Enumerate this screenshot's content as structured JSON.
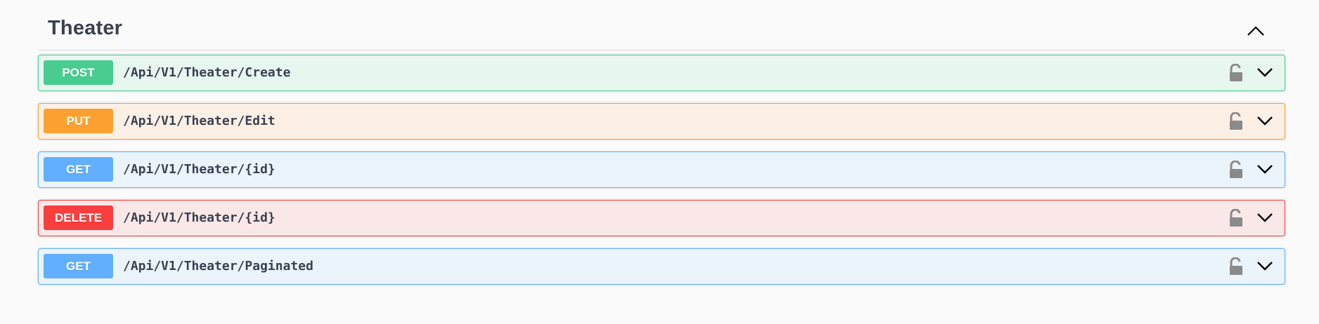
{
  "section": {
    "title": "Theater",
    "toggle_icon": "chevron-up-icon"
  },
  "operations": [
    {
      "method": "POST",
      "path": "/Api/V1/Theater/Create",
      "color": "#49cc90"
    },
    {
      "method": "PUT",
      "path": "/Api/V1/Theater/Edit",
      "color": "#fca130"
    },
    {
      "method": "GET",
      "path": "/Api/V1/Theater/{id}",
      "color": "#61affe"
    },
    {
      "method": "DELETE",
      "path": "/Api/V1/Theater/{id}",
      "color": "#f93e3e"
    },
    {
      "method": "GET",
      "path": "/Api/V1/Theater/Paginated",
      "color": "#61affe"
    }
  ],
  "icons": {
    "authorize": "unlocked-padlock-icon",
    "expand": "chevron-down-icon"
  }
}
